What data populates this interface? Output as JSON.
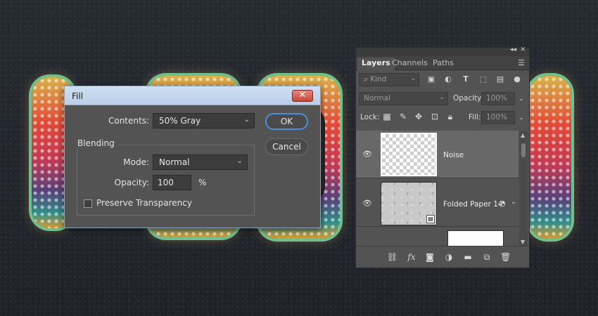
{
  "fill_dialog": {
    "title": "Fill",
    "close_glyph": "✕",
    "contents_label": "Contents:",
    "contents_value": "50% Gray",
    "blending_legend": "Blending",
    "mode_label": "Mode:",
    "mode_value": "Normal",
    "opacity_label": "Opacity:",
    "opacity_value": "100",
    "opacity_unit": "%",
    "preserve_label": "Preserve Transparency",
    "preserve_checked": false,
    "ok_label": "OK",
    "cancel_label": "Cancel"
  },
  "layers_panel": {
    "tabs": [
      "Layers",
      "Channels",
      "Paths"
    ],
    "active_tab": "Layers",
    "kind_placeholder": "Kind",
    "blend_mode": "Normal",
    "opacity_label": "Opacity:",
    "opacity_value": "100%",
    "lock_label": "Lock:",
    "fill_label": "Fill:",
    "fill_value": "100%",
    "layers": [
      {
        "name": "Noise",
        "selected": true,
        "visible": true,
        "thumb": "transparent"
      },
      {
        "name": "Folded Paper 14",
        "selected": false,
        "visible": true,
        "thumb": "paper-texture",
        "smart_object": true
      }
    ],
    "icons": {
      "filter": [
        "image-filter-icon",
        "adjustment-filter-icon",
        "type-filter-icon",
        "shape-filter-icon",
        "smart-object-filter-icon",
        "filter-toggle-icon"
      ],
      "lock": [
        "lock-transparent-pixels-icon",
        "lock-image-pixels-icon",
        "lock-position-icon",
        "lock-artboard-icon",
        "lock-all-icon"
      ],
      "bottom": [
        "link-layers-icon",
        "fx-icon",
        "add-mask-icon",
        "adjustment-layer-icon",
        "new-group-icon",
        "new-layer-icon",
        "delete-icon"
      ]
    }
  }
}
